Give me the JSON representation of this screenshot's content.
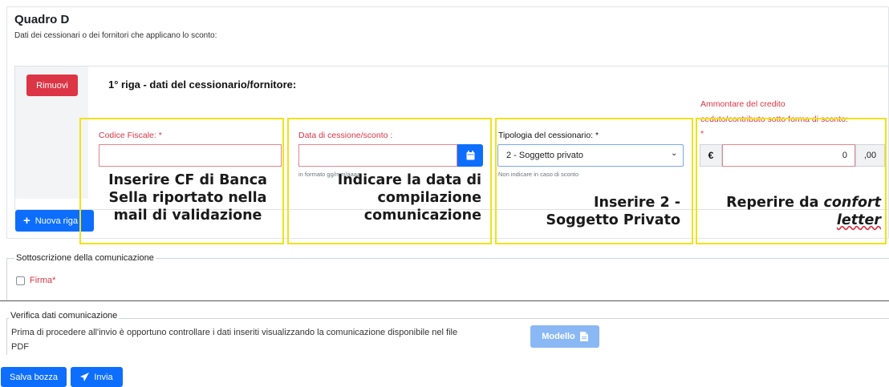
{
  "quadro": {
    "title": "Quadro D",
    "subtitle": "Dati dei cessionari o dei fornitori che applicano lo sconto:"
  },
  "row": {
    "remove_label": "Rimuovi",
    "title": "1° riga - dati del cessionario/fornitore:",
    "codice_fiscale_label": "Codice Fiscale: *",
    "data_label": "Data di cessione/sconto :",
    "data_help": "in formato gg/mm/aaaa",
    "tipologia_label": "Tipologia del cessionario: *",
    "tipologia_value": "2 - Soggetto privato",
    "tipologia_help": "Non indicare in caso di sconto",
    "ammontare_label_1": "Ammontare del credito",
    "ammontare_label_2": "ceduto/contributo sotto forma di sconto:",
    "ammontare_label_3": "*",
    "currency_symbol": "€",
    "amount_value": "0",
    "cents_value": ",00",
    "new_row_label": "Nuova riga"
  },
  "annotations": {
    "cf": [
      "Inserire CF di Banca",
      "Sella riportato nella",
      "mail di validazione"
    ],
    "data": [
      "Indicare la data di",
      "compilazione",
      "comunicazione"
    ],
    "tipologia": [
      "Inserire 2 -",
      "Soggetto Privato"
    ],
    "ammontare_prefix": "Reperire da ",
    "ammontare_italic": "confort",
    "ammontare_line2": "letter"
  },
  "sottoscrizione": {
    "legend": "Sottoscrizione della comunicazione",
    "firma_label": "Firma*"
  },
  "verifica": {
    "legend": "Verifica dati comunicazione",
    "text_line1": "Prima di procedere all'invio è opportuno controllare i dati inseriti visualizzando la comunicazione disponibile nel file",
    "text_line2": "PDF",
    "modello_label": "Modello"
  },
  "actions": {
    "salva_label": "Salva bozza",
    "invia_label": "Invia"
  },
  "colors": {
    "danger": "#dc3545",
    "primary": "#0d6efd",
    "annotation_border": "#f1e21a"
  }
}
